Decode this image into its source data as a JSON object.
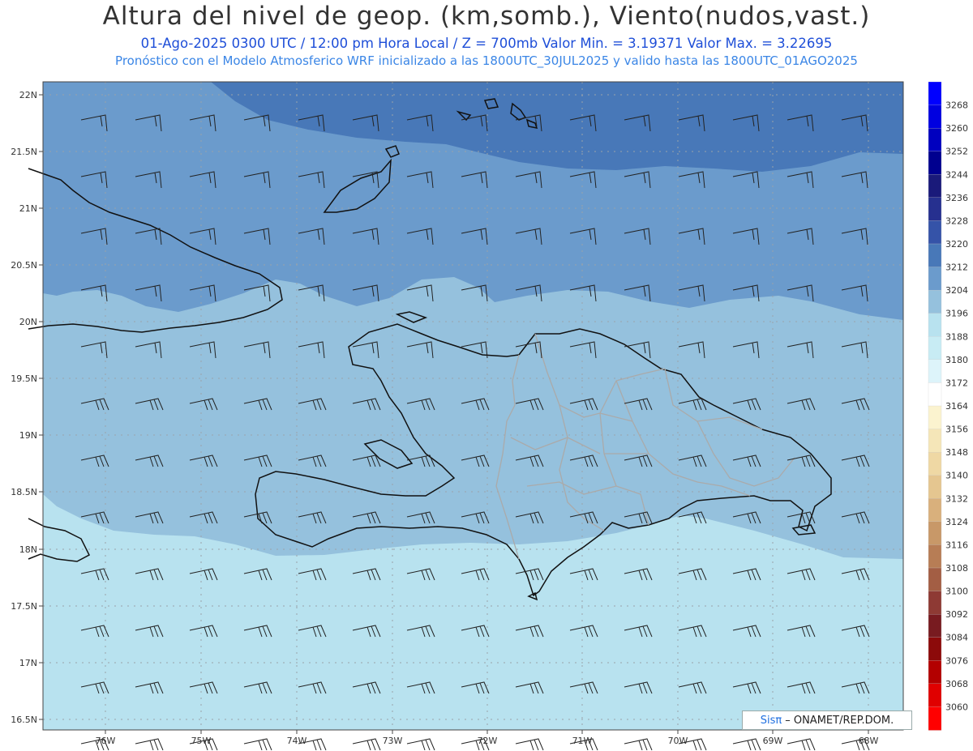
{
  "header": {
    "title": "Altura del nivel de geop. (km,somb.), Viento(nudos,vast.)",
    "line1": "01-Ago-2025  0300 UTC / 12:00 pm Hora Local / Z = 700mb    Valor Min. = 3.19371  Valor Max. = 3.22695",
    "line2": "Pronóstico con el Modelo Atmosferico WRF inicializado a las 1800UTC_30JUL2025 y valido hasta las  1800UTC_01AGO2025"
  },
  "axes": {
    "lat_labels": [
      "22N",
      "21.5N",
      "21N",
      "20.5N",
      "20N",
      "19.5N",
      "19N",
      "18.5N",
      "18N",
      "17.5N",
      "17N",
      "16.5N"
    ],
    "lon_labels": [
      "76W",
      "75W",
      "74W",
      "73W",
      "72W",
      "71W",
      "70W",
      "69W",
      "68W"
    ]
  },
  "colorbar": {
    "labels": [
      "3268",
      "3260",
      "3252",
      "3244",
      "3236",
      "3228",
      "3220",
      "3212",
      "3204",
      "3196",
      "3188",
      "3180",
      "3172",
      "3164",
      "3156",
      "3148",
      "3140",
      "3132",
      "3124",
      "3116",
      "3108",
      "3100",
      "3092",
      "3084",
      "3076",
      "3068",
      "3060"
    ],
    "colors": [
      "#0000ff",
      "#0000e0",
      "#0000bf",
      "#00008f",
      "#1a1a7a",
      "#26308f",
      "#3553a8",
      "#4878b8",
      "#6b9bcc",
      "#95c1dd",
      "#b8e2ef",
      "#c8ecf4",
      "#ddf4fa",
      "#ffffff",
      "#fbf3cf",
      "#f5e6b8",
      "#efd8a4",
      "#e5c690",
      "#d9b07c",
      "#c89868",
      "#b77d55",
      "#a35e44",
      "#8e3a34",
      "#781b20",
      "#8c0a0a",
      "#b30000",
      "#e00000",
      "#ff0000"
    ]
  },
  "colors": {
    "shade_3228": "#4878b8",
    "shade_3220": "#6b9bcc",
    "shade_3212": "#95c1dd",
    "shade_3204": "#b8e2ef",
    "coastline": "#111111",
    "provinces": "#aaaaaa",
    "grid": "#9aa3aa"
  },
  "credit": {
    "logo": "Sisπ",
    "text": "– ONAMET/REP.DOM."
  }
}
